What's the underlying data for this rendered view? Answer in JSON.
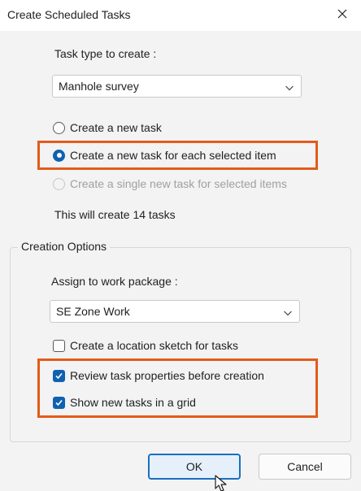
{
  "window": {
    "title": "Create Scheduled Tasks",
    "close_icon": "close-icon"
  },
  "task_type": {
    "label": "Task type to create :",
    "selected": "Manhole survey"
  },
  "create_mode": {
    "options": [
      {
        "label": "Create a new task",
        "checked": false,
        "disabled": false
      },
      {
        "label": "Create a new task for each selected item",
        "checked": true,
        "disabled": false
      },
      {
        "label": "Create a single new task for selected items",
        "checked": false,
        "disabled": true
      }
    ],
    "summary": "This will create 14 tasks"
  },
  "creation_options": {
    "legend": "Creation Options",
    "work_package_label": "Assign to work package :",
    "work_package_selected": "SE Zone Work",
    "checkboxes": [
      {
        "label": "Create a location sketch for tasks",
        "checked": false
      },
      {
        "label": "Review task properties before creation",
        "checked": true
      },
      {
        "label": "Show new tasks in a grid",
        "checked": true
      }
    ]
  },
  "buttons": {
    "ok": "OK",
    "cancel": "Cancel"
  },
  "colors": {
    "accent": "#0f62b0",
    "highlight": "#e35b1a",
    "ok_border": "#1a6fc0"
  }
}
